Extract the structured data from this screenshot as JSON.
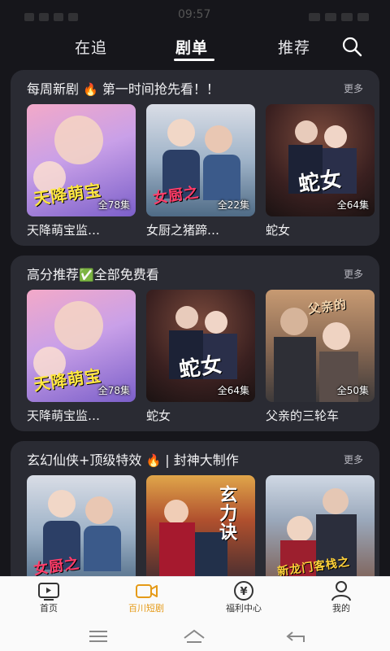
{
  "status_bar": {
    "time": "09:57"
  },
  "top_tabs": [
    {
      "label": "在追",
      "active": false
    },
    {
      "label": "剧单",
      "active": true
    },
    {
      "label": "推荐",
      "active": false
    }
  ],
  "sections": [
    {
      "title": "每周新剧",
      "title_emoji": "🔥",
      "title_suffix": "第一时间抢先看！！",
      "more": "更多",
      "cards": [
        {
          "name": "天降萌宝监…",
          "episodes": "全78集",
          "poster_title": "天降萌宝"
        },
        {
          "name": "女厨之猪蹄…",
          "episodes": "全22集",
          "poster_title": "女厨之"
        },
        {
          "name": "蛇女",
          "episodes": "全64集",
          "poster_title": "蛇女"
        }
      ]
    },
    {
      "title": "高分推荐",
      "title_emoji": "✅",
      "title_suffix": "全部免费看",
      "more": "更多",
      "cards": [
        {
          "name": "天降萌宝监…",
          "episodes": "全78集",
          "poster_title": "天降萌宝"
        },
        {
          "name": "蛇女",
          "episodes": "全64集",
          "poster_title": "蛇女"
        },
        {
          "name": "父亲的三轮车",
          "episodes": "全50集",
          "poster_title": "父亲的"
        }
      ]
    },
    {
      "title": "玄幻仙侠+顶级特效",
      "title_emoji": "🔥",
      "title_suffix": "| 封神大制作",
      "more": "更多",
      "cards": [
        {
          "name": "",
          "episodes": "",
          "poster_title": "女厨之"
        },
        {
          "name": "",
          "episodes": "",
          "poster_title": "玄力诀"
        },
        {
          "name": "",
          "episodes": "",
          "poster_title": "新龙门客栈之"
        }
      ]
    }
  ],
  "bottom_nav": [
    {
      "label": "首页",
      "icon": "tv-icon",
      "active": false
    },
    {
      "label": "百川短剧",
      "icon": "video-camera-icon",
      "active": true
    },
    {
      "label": "福利中心",
      "icon": "yen-coin-icon",
      "active": false
    },
    {
      "label": "我的",
      "icon": "user-icon",
      "active": false
    }
  ],
  "colors": {
    "background": "#16161b",
    "section_bg": "#2a2b33",
    "accent": "#e59a17"
  }
}
